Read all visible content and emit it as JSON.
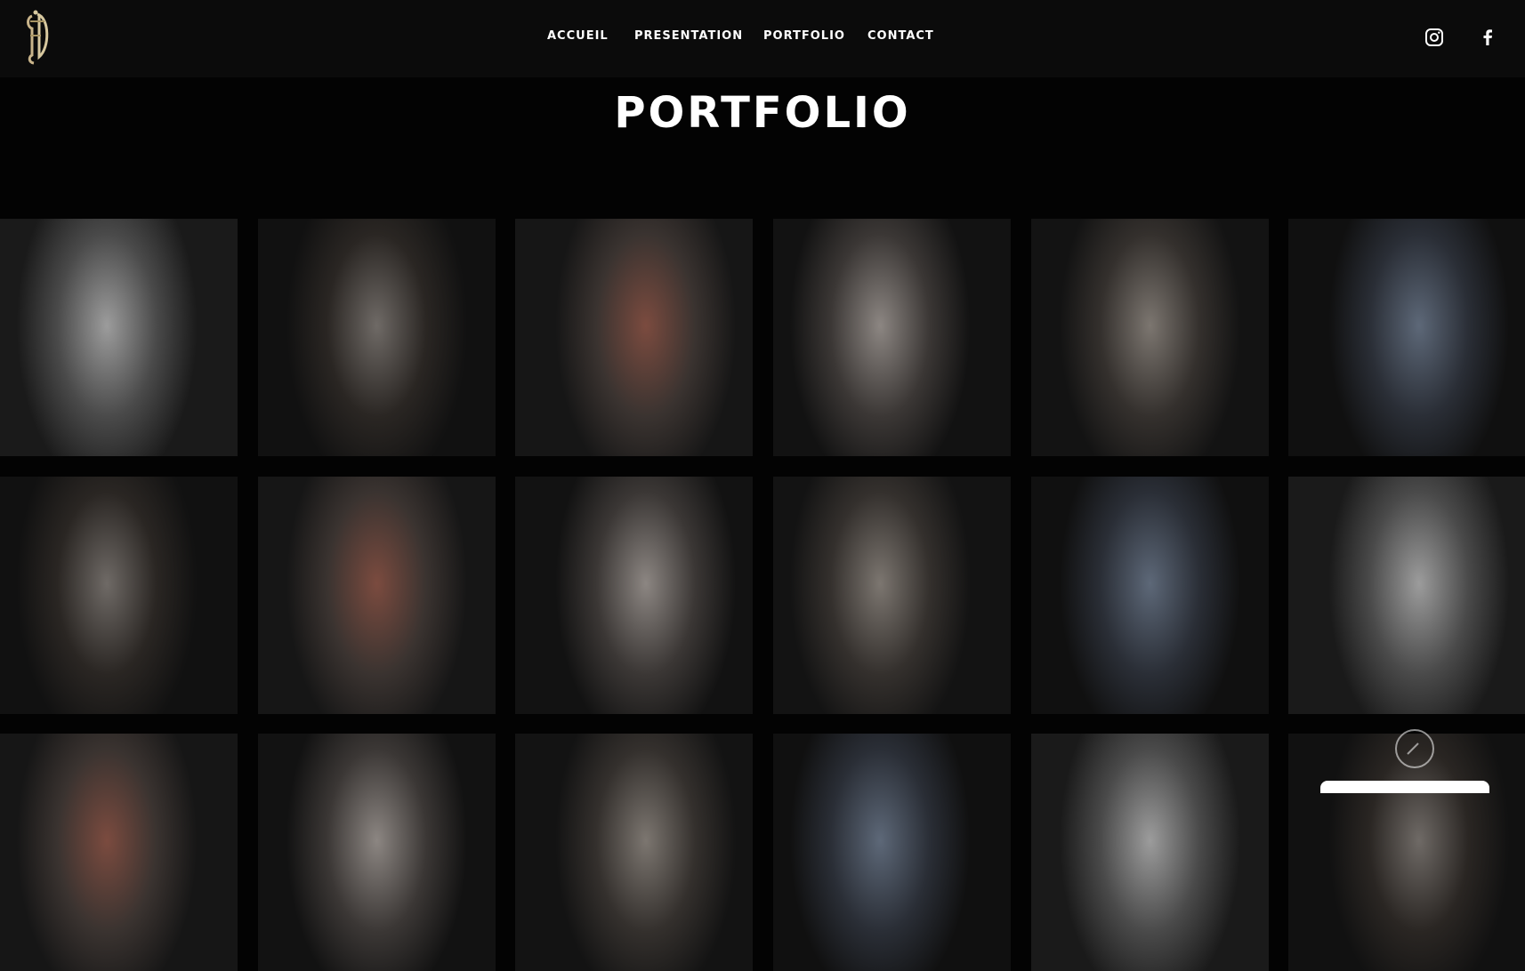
{
  "nav": {
    "items": [
      "ACCUEIL",
      "PRESENTATION",
      "PORTFOLIO",
      "CONTACT"
    ]
  },
  "header": {
    "social": [
      "instagram-icon",
      "facebook-icon"
    ]
  },
  "page": {
    "title": "PORTFOLIO"
  },
  "gallery": {
    "tiles": [
      {
        "name": "tattoo-photo-1"
      },
      {
        "name": "tattoo-photo-2"
      },
      {
        "name": "tattoo-photo-3"
      },
      {
        "name": "tattoo-photo-4"
      },
      {
        "name": "tattoo-photo-5"
      },
      {
        "name": "tattoo-photo-6"
      },
      {
        "name": "tattoo-photo-7"
      },
      {
        "name": "tattoo-photo-8"
      },
      {
        "name": "tattoo-photo-9"
      },
      {
        "name": "tattoo-photo-10"
      },
      {
        "name": "tattoo-photo-11"
      },
      {
        "name": "tattoo-photo-12"
      },
      {
        "name": "tattoo-photo-13"
      },
      {
        "name": "tattoo-photo-14"
      },
      {
        "name": "tattoo-photo-15"
      },
      {
        "name": "tattoo-photo-16"
      },
      {
        "name": "tattoo-photo-17"
      },
      {
        "name": "tattoo-photo-18"
      }
    ]
  },
  "colors": {
    "background": "#030303",
    "header": "#0b0b0b",
    "logo_gold": "#c9b48a"
  }
}
